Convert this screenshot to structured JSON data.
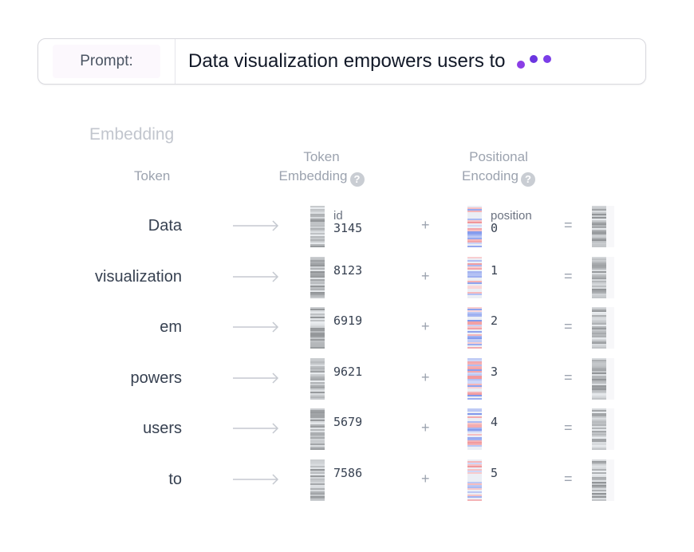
{
  "prompt": {
    "label": "Prompt:",
    "text": "Data visualization empowers users to"
  },
  "embedding": {
    "title": "Embedding",
    "headers": {
      "token": "Token",
      "token_embedding_line1": "Token",
      "token_embedding_line2": "Embedding",
      "positional_line1": "Positional",
      "positional_line2": "Encoding",
      "help_glyph": "?"
    },
    "id_label": "id",
    "position_label": "position",
    "plus": "+",
    "equals": "=",
    "rows": [
      {
        "token": "Data",
        "id": "3145",
        "position": "0"
      },
      {
        "token": "visualization",
        "id": "8123",
        "position": "1"
      },
      {
        "token": "em",
        "id": "6919",
        "position": "2"
      },
      {
        "token": "powers",
        "id": "9621",
        "position": "3"
      },
      {
        "token": "users",
        "id": "5679",
        "position": "4"
      },
      {
        "token": "to",
        "id": "7586",
        "position": "5"
      }
    ]
  },
  "colors": {
    "dots": [
      "#8b3ee6",
      "#6b35e0",
      "#7b3ee8"
    ],
    "gray_stripes": "#9ca3af",
    "pos_blue": "#8fa8ef",
    "pos_red": "#f0a2a6"
  },
  "icons": {
    "help": "help-icon",
    "arrow": "right-arrow-icon",
    "loading": "loading-dots-icon"
  }
}
